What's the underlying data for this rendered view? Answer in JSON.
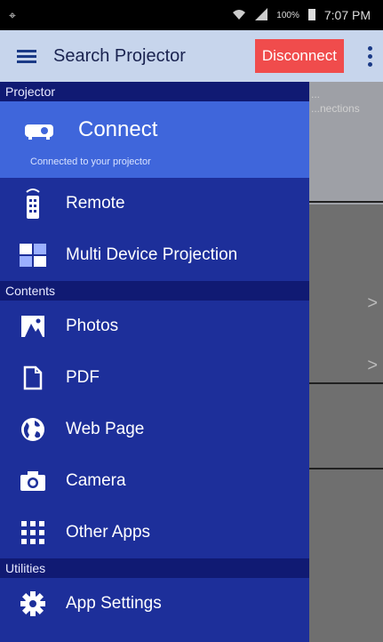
{
  "statusbar": {
    "left_symbol": "⌖",
    "battery": "100%",
    "time": "7:07 PM"
  },
  "appbar": {
    "title": "Search Projector",
    "disconnect_label": "Disconnect"
  },
  "background": {
    "top_text_1": "...",
    "top_text_2": "...nections",
    "arrow_1": ">",
    "arrow_2": ">"
  },
  "drawer": {
    "section_projector": "Projector",
    "connect_label": "Connect",
    "connect_sub": "Connected to your projector",
    "remote_label": "Remote",
    "multi_label": "Multi Device Projection",
    "section_contents": "Contents",
    "photos_label": "Photos",
    "pdf_label": "PDF",
    "web_label": "Web Page",
    "camera_label": "Camera",
    "other_label": "Other Apps",
    "section_utilities": "Utilities",
    "settings_label": "App Settings"
  },
  "colors": {
    "drawer_bg": "#1d2f9a",
    "header_bg": "#101a73",
    "connect_bg": "#3f66db",
    "appbar_bg": "#c7d5ec",
    "disconnect_bg": "#f04c4c"
  }
}
